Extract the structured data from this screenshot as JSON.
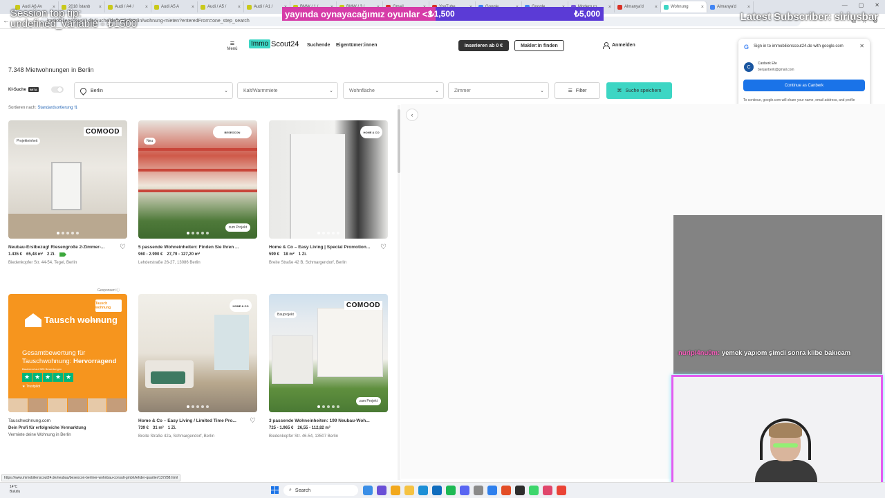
{
  "browser": {
    "tabs": [
      {
        "label": "Audi A6 Av",
        "color": "#c9c91a"
      },
      {
        "label": "2018 İstanb",
        "color": "#c9c91a"
      },
      {
        "label": "Audi / A4 /",
        "color": "#c9c91a"
      },
      {
        "label": "Audi A5 A",
        "color": "#c9c91a"
      },
      {
        "label": "Audi / A5 /",
        "color": "#c9c91a"
      },
      {
        "label": "Audi / A1 /",
        "color": "#c9c91a"
      },
      {
        "label": "BMW / 1 /",
        "color": "#c9c91a"
      },
      {
        "label": "BMW / 3 /",
        "color": "#c9c91a"
      },
      {
        "label": "Gmail",
        "color": "#d93025"
      },
      {
        "label": "YouTube",
        "color": "#d93025"
      },
      {
        "label": "Google",
        "color": "#4285f4"
      },
      {
        "label": "Google",
        "color": "#4285f4"
      },
      {
        "label": "Modern ro",
        "color": "#7b5cd6"
      },
      {
        "label": "Almanya'd",
        "color": "#d93025"
      },
      {
        "label": "Wohnung",
        "color": "#3dd6c4"
      },
      {
        "label": "Almanya'd",
        "color": "#4285f4"
      }
    ],
    "active_tab_index": 14,
    "url": "immobilienscout24.de/Suche/de/berlin/berlin/wohnung-mieten?enteredFrom=one_step_search"
  },
  "stream": {
    "session_tip": "Session top tip:",
    "session_tip_value": "undefined_variable - ₺1500",
    "banner_text": "yayında oynayacağımız oyunlar <3",
    "banner_value_1": "₺1,500",
    "banner_value_2": "₺5,000",
    "latest_subscriber": "Latest Subscriber: siriusbar",
    "chat_nick": "nuripi4nu0m:",
    "chat_text": "yemek yapıom şimdi sonra klibe bakıcam"
  },
  "header": {
    "menu_label": "Menü",
    "logo_box": "Immo",
    "logo_text": "Scout24",
    "nav_search": "Suchende",
    "nav_owners": "Eigentümer:innen",
    "insert_button": "Inserieren ab 0 €",
    "agent_button": "Makler:in finden",
    "signin": "Anmelden"
  },
  "google_popup": {
    "logo": "G",
    "title": "Sign in to immobilienscout24.de with google.com",
    "avatar_letter": "C",
    "name": "Canberk Efe",
    "email": "benjanberk@gmail.com",
    "continue_button": "Continue as Canberk",
    "note": "To continue, google.com will share your name, email address, and profile picture with this site."
  },
  "page": {
    "title": "7.348 Mietwohnungen in Berlin",
    "ki_label": "KI-Suche",
    "beta": "BETA",
    "location": "Berlin",
    "rent_placeholder": "Kalt/Warmmiete",
    "area_placeholder": "Wohnfläche",
    "rooms_placeholder": "Zimmer",
    "filter_button": "Filter",
    "save_search_button": "Suche speichern",
    "sort_label": "Sortieren nach:",
    "sort_value": "Standardsortierung ⇅",
    "sponsored": "Gesponsert ⓘ"
  },
  "listings": [
    {
      "title": "Neubau-Erstbezug! Riesengroße 2-Zimmer-...",
      "price": "1.435 €",
      "area": "65,48 m²",
      "rooms": "2 Zi.",
      "address": "Biedenkopfer Str. 44-54, Tegel, Berlin",
      "tag": "Projekteinheit",
      "brand": "COMOOD",
      "energy": true
    },
    {
      "title": "5 passende Wohneinheiten: Finden Sie Ihren ...",
      "price": "960 - 2.990 €",
      "area": "27,79 - 127,20 m²",
      "rooms": "",
      "address": "Lehderstraße 26-27, 13086 Berlin",
      "tag": "Neu",
      "brand": "BESEOCON",
      "project_button": "zum Projekt"
    },
    {
      "title": "Home & Co – Easy Living | Special Promotion...",
      "price": "599 €",
      "area": "18 m²",
      "rooms": "1 Zi.",
      "address": "Breite Straße 42 B, Schmargendorf, Berlin",
      "brand": "HOME & CO"
    },
    {
      "title": "Tauschwohnung.com",
      "subtitle": "Dein Profi für erfolgreiche Vermarktung",
      "address": "Vermiete deine Wohnung in Berlin",
      "ad_logo": "Tausch wohnung",
      "ad_sub": "doch glücklich",
      "ad_badge": "Tausch wohnung",
      "ad_headline": "Gesamtbewertung für Tauschwohnung:",
      "ad_rating": "Hervorragend",
      "ad_small": "Basierend auf 325 Bewertungen",
      "ad_trustpilot": "★ Trustpilot"
    },
    {
      "title": "Home & Co – Easy Living / Limited Time Pro...",
      "price": "739 €",
      "area": "31 m²",
      "rooms": "1 Zi.",
      "address": "Breite Straße 42a, Schmargendorf, Berlin",
      "brand": "HOME & CO"
    },
    {
      "title": "3 passende Wohneinheiten: 199 Neubau-Woh...",
      "price": "725 - 1.965 €",
      "area": "26,55 - 112,82 m²",
      "rooms": "",
      "address": "Biedenkopfer Str. 46-54, 13507 Berlin",
      "tag": "Bauprojekt",
      "brand": "COMOOD",
      "project_button": "zum Projekt"
    }
  ],
  "status_link": "https://www.immobilienscout24.de/neubau/beseocon-berliner-wohnbau-consult-gmbh/lehder-quartier/137288.html",
  "taskbar": {
    "temp": "14°C",
    "weather": "Bulutlu",
    "search": "Search"
  },
  "colors": {
    "brand_teal": "#3dd6c4",
    "ad_orange": "#f6951e",
    "google_blue": "#1a73e8",
    "banner_purple": "#5b3bd6",
    "cam_border": "#e35cf0"
  }
}
